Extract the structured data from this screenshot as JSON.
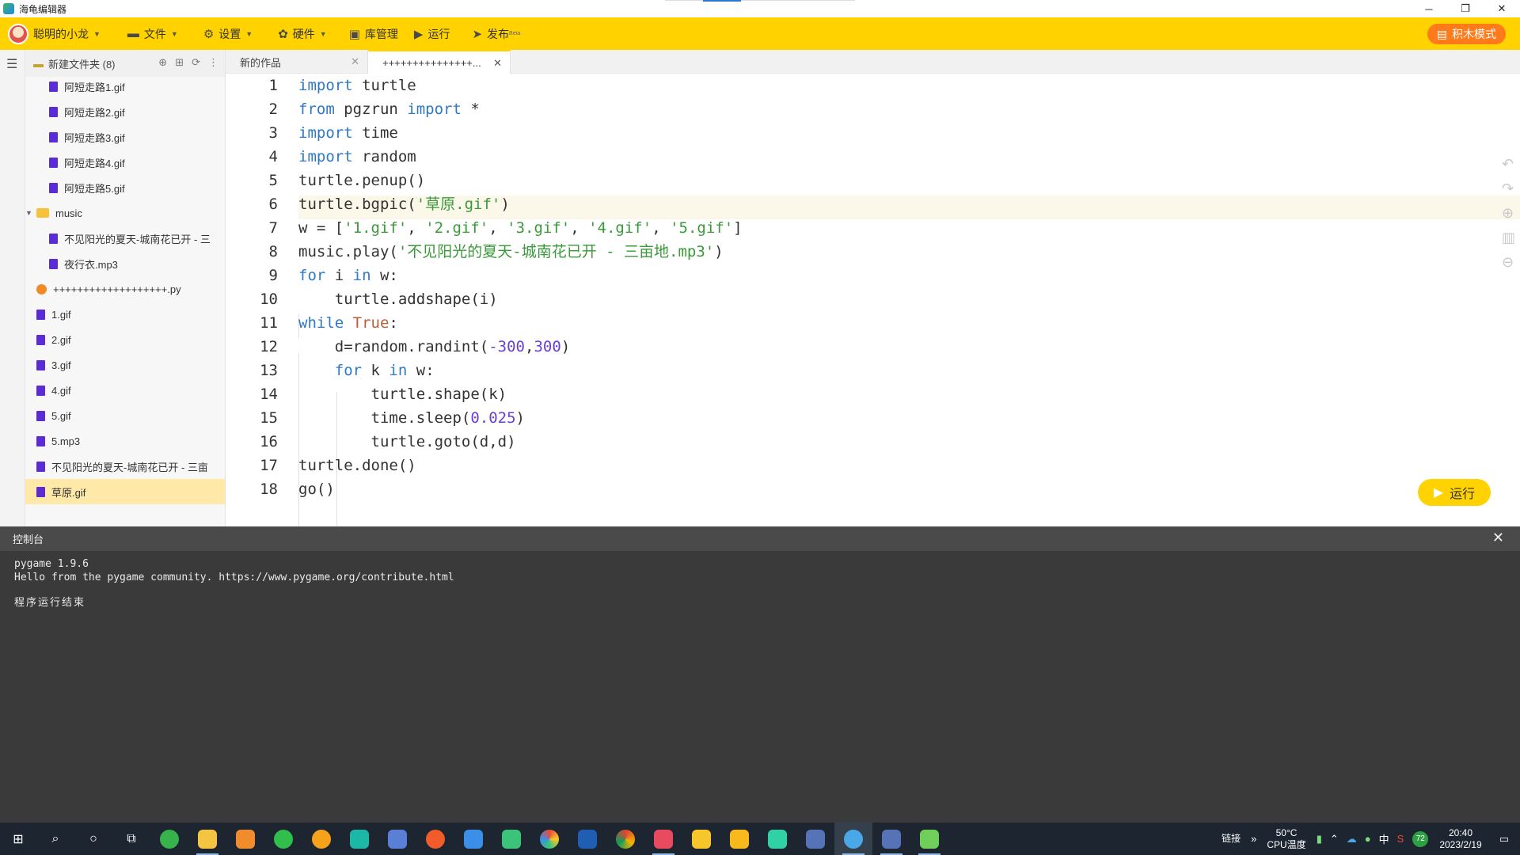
{
  "window": {
    "title": "海龟编辑器",
    "minimize": "─",
    "maximize": "❐",
    "close": "✕"
  },
  "toolbar": {
    "user": "聪明的小龙",
    "file": "文件",
    "settings": "设置",
    "hardware": "硬件",
    "library": "库管理",
    "run": "运行",
    "publish": "发布",
    "publish_beta": "Beta",
    "block_mode": "积木模式",
    "colors": {
      "bar": "#ffd200",
      "block_mode": "#ff7a1a"
    }
  },
  "explorer": {
    "folder_title": "新建文件夹 (8)",
    "items": [
      {
        "name": "阿短走路1.gif",
        "type": "file",
        "indent": 2
      },
      {
        "name": "阿短走路2.gif",
        "type": "file",
        "indent": 2
      },
      {
        "name": "阿短走路3.gif",
        "type": "file",
        "indent": 2
      },
      {
        "name": "阿短走路4.gif",
        "type": "file",
        "indent": 2
      },
      {
        "name": "阿短走路5.gif",
        "type": "file",
        "indent": 2
      },
      {
        "name": "music",
        "type": "folder",
        "indent": 0
      },
      {
        "name": "不见阳光的夏天-城南花已开 - 三",
        "type": "file",
        "indent": 2
      },
      {
        "name": "夜行衣.mp3",
        "type": "file",
        "indent": 2
      },
      {
        "name": "+++++++++++++++++++.py",
        "type": "py",
        "indent": 1
      },
      {
        "name": "1.gif",
        "type": "file",
        "indent": 1
      },
      {
        "name": "2.gif",
        "type": "file",
        "indent": 1
      },
      {
        "name": "3.gif",
        "type": "file",
        "indent": 1
      },
      {
        "name": "4.gif",
        "type": "file",
        "indent": 1
      },
      {
        "name": "5.gif",
        "type": "file",
        "indent": 1
      },
      {
        "name": "5.mp3",
        "type": "file",
        "indent": 1
      },
      {
        "name": "不见阳光的夏天-城南花已开 - 三亩",
        "type": "file",
        "indent": 1
      },
      {
        "name": "草原.gif",
        "type": "file",
        "indent": 1,
        "selected": true
      }
    ]
  },
  "tabs": [
    {
      "label": "新的作品",
      "active": false
    },
    {
      "label": "+++++++++++++++...",
      "active": true
    }
  ],
  "editor": {
    "line_numbers": [
      "1",
      "2",
      "3",
      "4",
      "5",
      "6",
      "7",
      "8",
      "9",
      "10",
      "11",
      "12",
      "13",
      "14",
      "15",
      "16",
      "17",
      "18"
    ],
    "current_line": 6
  },
  "run_button": "运行",
  "console": {
    "title": "控制台",
    "lines": [
      "pygame 1.9.6",
      "Hello from the pygame community. https://www.pygame.org/contribute.html"
    ],
    "end_message": "程序运行结束"
  },
  "taskbar": {
    "link_label": "链接",
    "temp": "50°C",
    "temp_label": "CPU温度",
    "ime": "中",
    "badge": "72",
    "time": "20:40",
    "date": "2023/2/19"
  }
}
